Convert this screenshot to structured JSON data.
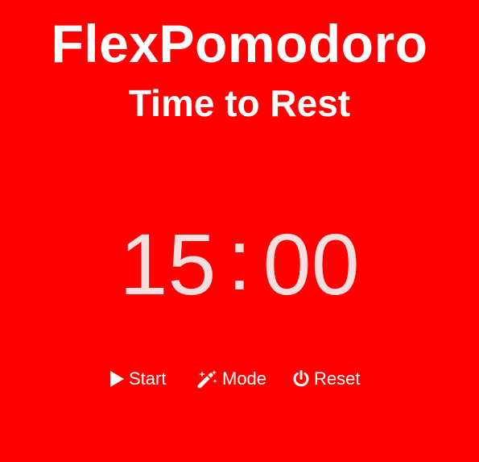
{
  "app": {
    "title": "FlexPomodoro",
    "subtitle": "Time to Rest",
    "background_color": "#ff0000"
  },
  "timer": {
    "minutes": "15",
    "separator": ":",
    "seconds": "00"
  },
  "controls": {
    "start": {
      "label": "Start",
      "icon": "play-icon"
    },
    "mode": {
      "label": "Mode",
      "icon": "magic-wand-icon"
    },
    "reset": {
      "label": "Reset",
      "icon": "power-icon"
    }
  }
}
